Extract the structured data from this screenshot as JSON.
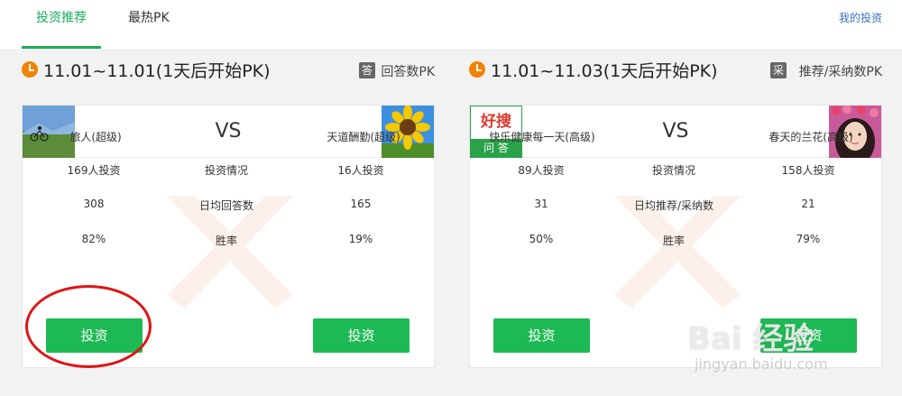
{
  "tabs": [
    {
      "label": "投资推荐",
      "active": true
    },
    {
      "label": "最热PK",
      "active": false
    }
  ],
  "my_invest_link": "我的投资",
  "accent_color": "#1aad5b",
  "panels": [
    {
      "period": "11.01~11.01(1天后开始PK)",
      "type_badge": "答",
      "type_label": "回答数PK",
      "vs": "VS",
      "left": {
        "name": "旅人(超级)",
        "investors": "169人投资",
        "daily": "308",
        "win_rate": "82%",
        "invest_button": "投资"
      },
      "right": {
        "name": "天道酬勤(超级)",
        "investors": "16人投资",
        "daily": "165",
        "win_rate": "19%",
        "invest_button": "投资"
      },
      "middle": {
        "investment": "投资情况",
        "daily_label": "日均回答数",
        "win_label": "胜率"
      }
    },
    {
      "period": "11.01~11.03(1天后开始PK)",
      "type_badge": "采",
      "type_label": "推荐/采纳数PK",
      "vs": "VS",
      "left": {
        "name": "快乐健康每一天(高级)",
        "investors": "89人投资",
        "daily": "31",
        "win_rate": "50%",
        "invest_button": "投资",
        "logo_top": "好搜",
        "logo_bottom": "问 答"
      },
      "right": {
        "name": "春天的兰花(高级)",
        "investors": "158人投资",
        "daily": "21",
        "win_rate": "79%",
        "invest_button": "投资"
      },
      "middle": {
        "investment": "投资情况",
        "daily_label": "日均推荐/采纳数",
        "win_label": "胜率"
      }
    }
  ],
  "watermark": {
    "brand": "Bai 经验",
    "url": "jingyan.baidu.com"
  }
}
